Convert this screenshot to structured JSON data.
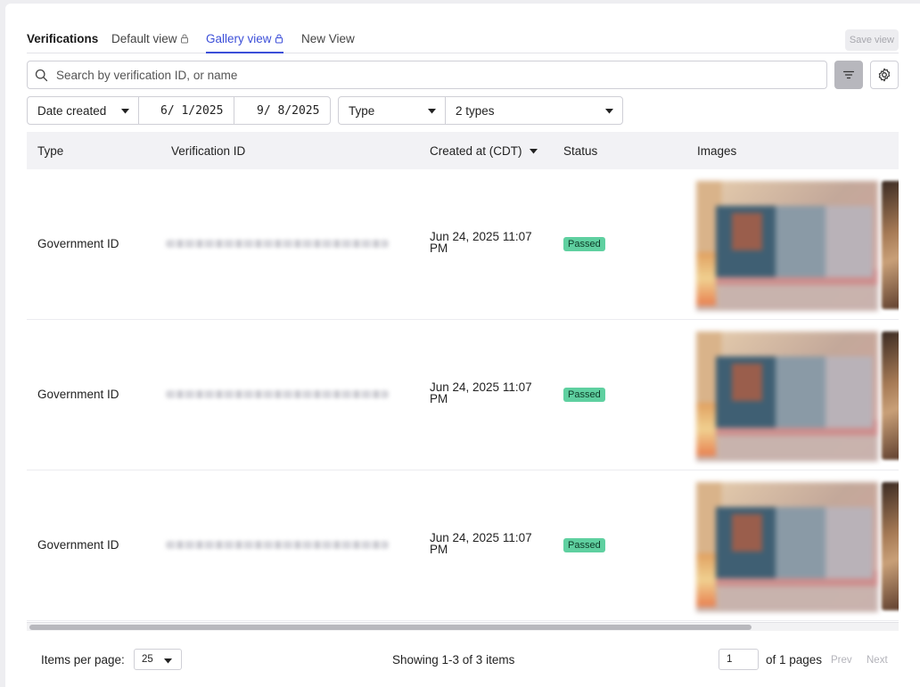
{
  "tabs": {
    "title": "Verifications",
    "items": [
      {
        "label": "Default view",
        "locked": true,
        "active": false
      },
      {
        "label": "Gallery view",
        "locked": true,
        "active": true
      },
      {
        "label": "New View",
        "locked": false,
        "active": false
      }
    ],
    "save_label": "Save view"
  },
  "search": {
    "placeholder": "Search by verification ID, or name",
    "value": ""
  },
  "filters": {
    "date_field": "Date created",
    "date_from": "6/ 1/2025",
    "date_to": "9/ 8/2025",
    "type_field": "Type",
    "type_value": "2 types"
  },
  "table": {
    "columns": [
      "Type",
      "Verification ID",
      "Created at (CDT)",
      "Status",
      "Images"
    ],
    "sorted_column": "Created at (CDT)",
    "rows": [
      {
        "type": "Government ID",
        "created_at": "Jun 24, 2025 11:07 PM",
        "status": "Passed"
      },
      {
        "type": "Government ID",
        "created_at": "Jun 24, 2025 11:07 PM",
        "status": "Passed"
      },
      {
        "type": "Government ID",
        "created_at": "Jun 24, 2025 11:07 PM",
        "status": "Passed"
      }
    ]
  },
  "footer": {
    "items_per_page_label": "Items per page:",
    "items_per_page": "25",
    "showing": "Showing 1-3 of 3 items",
    "current_page": "1",
    "of_pages": "of 1 pages",
    "prev": "Prev",
    "next": "Next"
  },
  "colors": {
    "accent": "#3c4fd8",
    "passed_badge": "#5fd0a0"
  },
  "icons": [
    "lock-icon",
    "search-icon",
    "filter-icon",
    "gear-icon",
    "caret-down-icon",
    "sort-desc-icon"
  ]
}
